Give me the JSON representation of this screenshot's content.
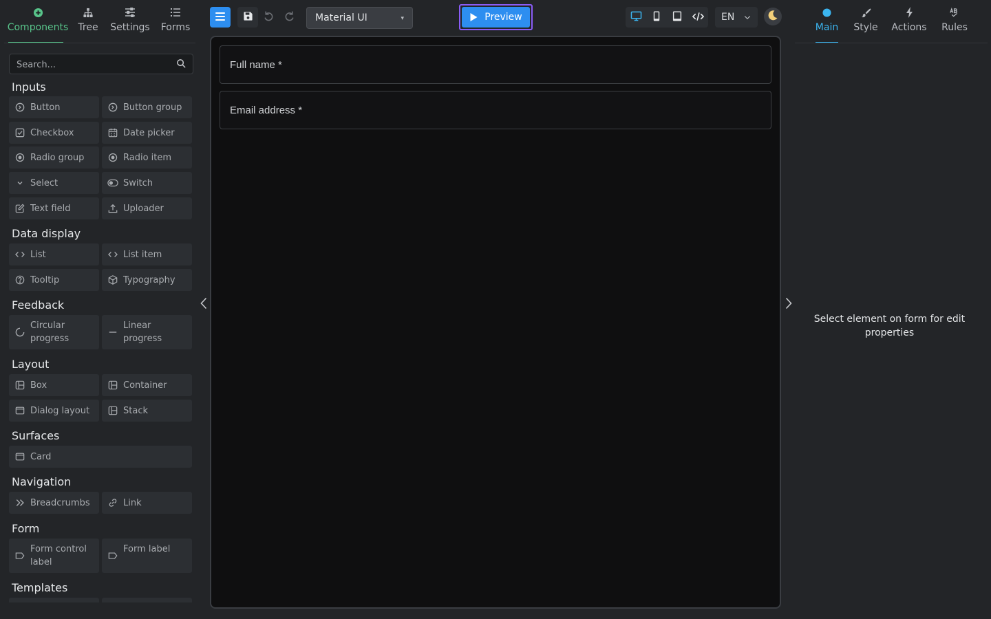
{
  "left_tabs": [
    {
      "label": "Components",
      "icon": "plus-circle-icon",
      "active": true
    },
    {
      "label": "Tree",
      "icon": "tree-icon"
    },
    {
      "label": "Settings",
      "icon": "sliders-icon"
    },
    {
      "label": "Forms",
      "icon": "list-icon"
    }
  ],
  "search": {
    "placeholder": "Search..."
  },
  "palette": {
    "inputs": {
      "title": "Inputs",
      "items": [
        "Button",
        "Button group",
        "Checkbox",
        "Date picker",
        "Radio group",
        "Radio item",
        "Select",
        "Switch",
        "Text field",
        "Uploader"
      ]
    },
    "data_display": {
      "title": "Data display",
      "items": [
        "List",
        "List item",
        "Tooltip",
        "Typography"
      ]
    },
    "feedback": {
      "title": "Feedback",
      "items": [
        "Circular progress",
        "Linear progress"
      ]
    },
    "layout": {
      "title": "Layout",
      "items": [
        "Box",
        "Container",
        "Dialog layout",
        "Stack"
      ]
    },
    "surfaces": {
      "title": "Surfaces",
      "items": [
        "Card"
      ]
    },
    "navigation": {
      "title": "Navigation",
      "items": [
        "Breadcrumbs",
        "Link"
      ]
    },
    "form": {
      "title": "Form",
      "items": [
        "Form control label",
        "Form label"
      ]
    },
    "templates": {
      "title": "Templates"
    }
  },
  "toolbar": {
    "theme_value": "Material UI",
    "preview_label": "Preview",
    "language": "EN",
    "accent_color": "#2d8ef0",
    "highlight_color": "#8a5cf6"
  },
  "canvas": {
    "fields": [
      {
        "label": "Full name *"
      },
      {
        "label": "Email address *"
      }
    ]
  },
  "right_tabs": [
    {
      "label": "Main",
      "icon": "circle-icon",
      "active": true
    },
    {
      "label": "Style",
      "icon": "brush-icon"
    },
    {
      "label": "Actions",
      "icon": "lightning-icon"
    },
    {
      "label": "Rules",
      "icon": "rules-icon"
    }
  ],
  "props_hint": "Select element on form for edit properties"
}
